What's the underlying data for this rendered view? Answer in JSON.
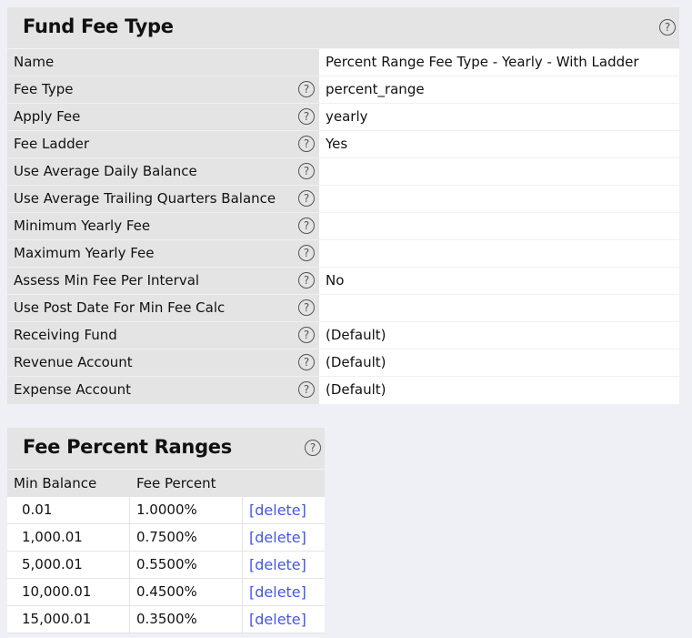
{
  "fee_type": {
    "title": "Fund Fee Type",
    "rows": [
      {
        "label": "Name",
        "value": "Percent Range Fee Type - Yearly - With Ladder",
        "help": false
      },
      {
        "label": "Fee Type",
        "value": "percent_range",
        "help": true
      },
      {
        "label": "Apply Fee",
        "value": "yearly",
        "help": true
      },
      {
        "label": "Fee Ladder",
        "value": "Yes",
        "help": true
      },
      {
        "label": "Use Average Daily Balance",
        "value": "",
        "help": true
      },
      {
        "label": "Use Average Trailing Quarters Balance",
        "value": "",
        "help": true
      },
      {
        "label": "Minimum Yearly Fee",
        "value": "",
        "help": true
      },
      {
        "label": "Maximum Yearly Fee",
        "value": "",
        "help": true
      },
      {
        "label": "Assess Min Fee Per Interval",
        "value": "No",
        "help": true
      },
      {
        "label": "Use Post Date For Min Fee Calc",
        "value": "",
        "help": true
      },
      {
        "label": "Receiving Fund",
        "value": "(Default)",
        "help": true
      },
      {
        "label": "Revenue Account",
        "value": "(Default)",
        "help": true
      },
      {
        "label": "Expense Account",
        "value": "(Default)",
        "help": true
      }
    ]
  },
  "ranges": {
    "title": "Fee Percent Ranges",
    "columns": [
      "Min Balance",
      "Fee Percent"
    ],
    "delete_label": "[delete]",
    "rows": [
      {
        "min": "0.01",
        "pct": "1.0000%"
      },
      {
        "min": "1,000.01",
        "pct": "0.7500%"
      },
      {
        "min": "5,000.01",
        "pct": "0.5500%"
      },
      {
        "min": "10,000.01",
        "pct": "0.4500%"
      },
      {
        "min": "15,000.01",
        "pct": "0.3500%"
      }
    ]
  },
  "help_glyph": "?"
}
